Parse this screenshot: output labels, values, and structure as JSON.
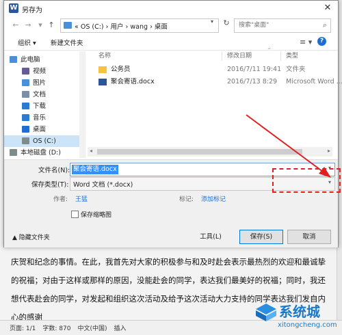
{
  "dialog": {
    "title": "另存为",
    "close": "✕",
    "nav": {
      "back": "←",
      "forward": "→",
      "dropdown": "▾",
      "up": "↑"
    },
    "breadcrumb": [
      "«",
      "OS (C:)",
      "›",
      "用户",
      "›",
      "wang",
      "›",
      "桌面"
    ],
    "search_placeholder": "搜索\"桌面\"",
    "toolbar": {
      "organize": "组织 ▾",
      "new_folder": "新建文件夹",
      "view": "≡ ▾",
      "help": "?"
    },
    "sidebar": [
      {
        "label": "此电脑",
        "color": "#4a90d9"
      },
      {
        "label": "视频",
        "color": "#6b5b95"
      },
      {
        "label": "图片",
        "color": "#4a90d9"
      },
      {
        "label": "文档",
        "color": "#7a8fa8"
      },
      {
        "label": "下载",
        "color": "#2a7bd1"
      },
      {
        "label": "音乐",
        "color": "#2a7bd1"
      },
      {
        "label": "桌面",
        "color": "#1f6fd0"
      },
      {
        "label": "OS (C:)",
        "color": "#7f8c8d"
      },
      {
        "label": "本地磁盘 (D:)",
        "color": "#7f8c8d"
      }
    ],
    "columns": {
      "name": "名称",
      "date": "修改日期",
      "type": "类型"
    },
    "files": [
      {
        "name": "公务员",
        "date": "2016/7/11 19:41",
        "type": "文件夹",
        "kind": "folder"
      },
      {
        "name": "聚会寄语.docx",
        "date": "2016/7/13 8:29",
        "type": "Microsoft Word ...",
        "kind": "docx"
      }
    ],
    "form": {
      "filename_label": "文件名(N):",
      "filename_value": "聚会寄语.docx",
      "filetype_label": "保存类型(T):",
      "filetype_value": "Word 文档 (*.docx)",
      "author_label": "作者:",
      "author_value": "王猛",
      "tags_label": "标记:",
      "tags_value": "添加标记",
      "thumbnail_label": "保存缩略图",
      "hide_folders": "▲ 隐藏文件夹",
      "tools": "工具(L)",
      "save": "保存(S)",
      "cancel": "取消"
    }
  },
  "document": {
    "lines": [
      "庆贺和纪念的事情。在此，我首先对大家的积极参与和及时赴会表示最热烈的欢迎和最诚挚",
      "的祝福；对由于这样或那样的原因，没能赴会的同学，表达我们最美好的祝福；同时，我还",
      "想代表赴会的同学，对发起和组织这次活动及给予这次活动大力支持的同学表达我们发自内",
      "心的感谢"
    ],
    "status": {
      "page": "页面: 1/1",
      "words": "字数: 870",
      "lang": "中文(中国)",
      "mode": "插入"
    }
  },
  "watermark": {
    "text": "系统城",
    "url": "xitongcheng.com"
  },
  "colors": {
    "accent": "#0078d7",
    "selection": "#3390ff",
    "annotation": "#e02020"
  }
}
